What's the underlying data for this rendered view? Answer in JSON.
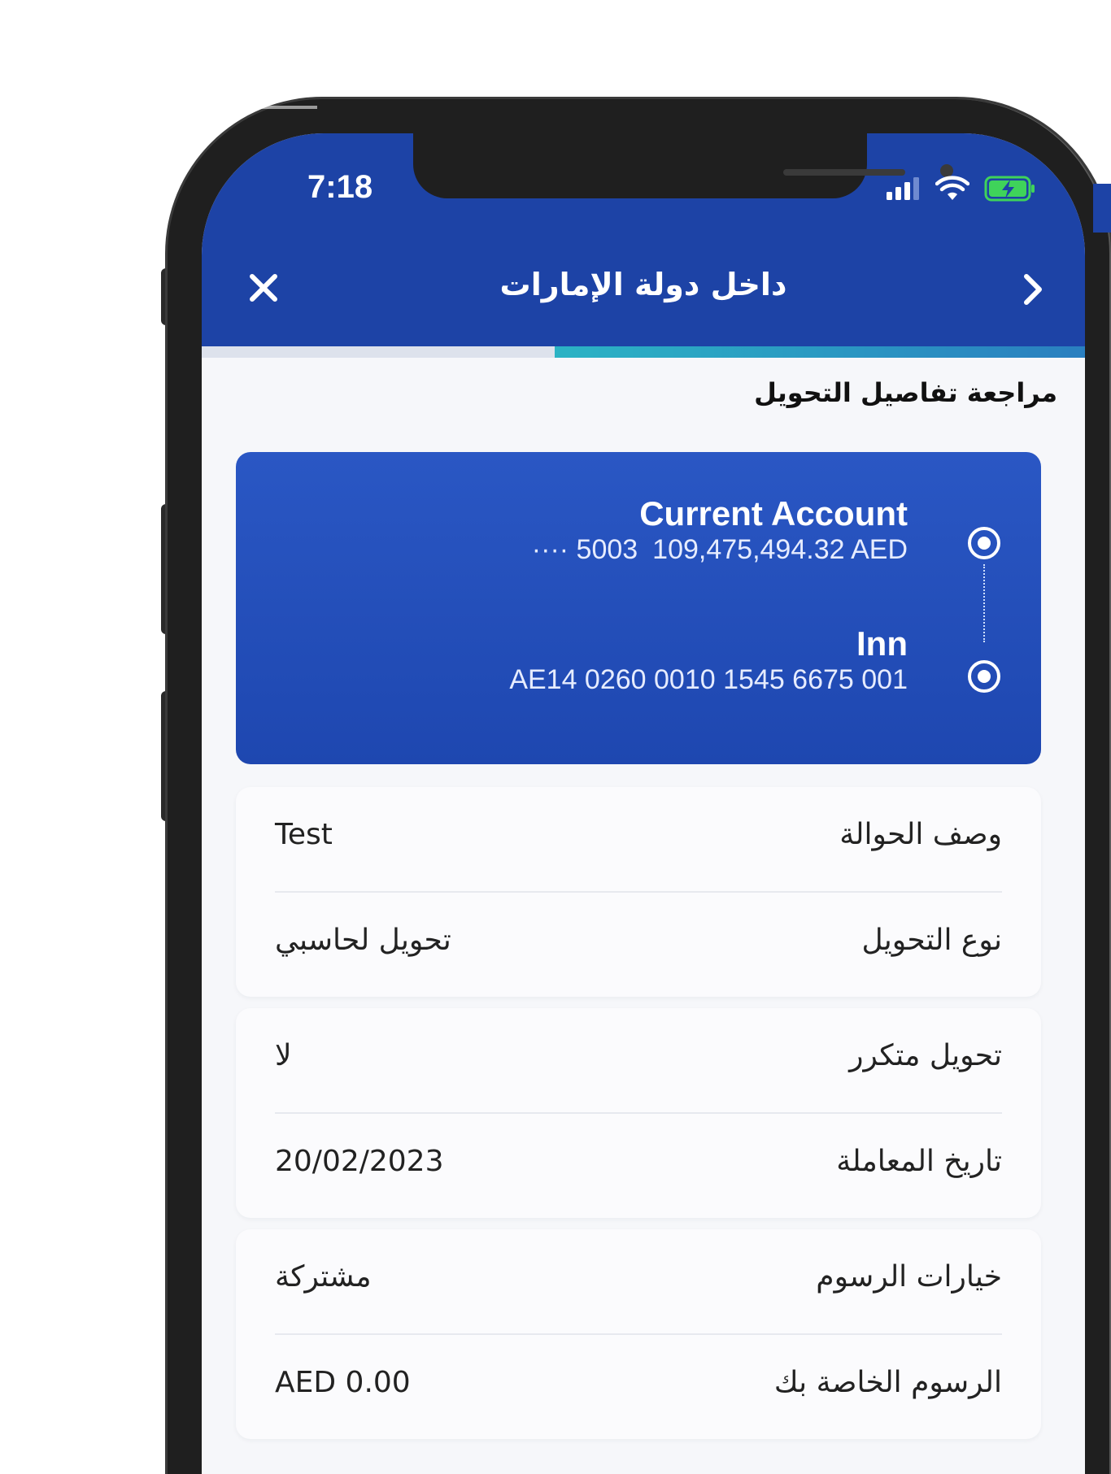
{
  "status_bar": {
    "time": "7:18"
  },
  "header": {
    "title": "داخل دولة الإمارات",
    "close_icon": "close-icon",
    "back_icon": "chevron-right-icon"
  },
  "progress": {
    "fraction": 0.6
  },
  "section": {
    "title": "مراجعة تفاصيل التحويل"
  },
  "from_account": {
    "name": "Current Account",
    "number_masked": "···· 5003",
    "balance": "109,475,494.32 AED"
  },
  "to_account": {
    "name": "Inn",
    "iban": "AE14 0260 0010 1545 6675 001"
  },
  "details": [
    {
      "label": "وصف الحوالة",
      "value": "Test"
    },
    {
      "label": "نوع التحويل",
      "value": "تحويل لحاسبي"
    },
    {
      "label": "تحويل متكرر",
      "value": "لا"
    },
    {
      "label": "تاريخ المعاملة",
      "value": "20/02/2023"
    },
    {
      "label": "خيارات الرسوم",
      "value": "مشتركة"
    },
    {
      "label": "الرسوم الخاصة بك",
      "value": "AED 0.00"
    }
  ],
  "colors": {
    "header_blue": "#1d43a6",
    "card_blue": "#2a57c4",
    "progress_teal": "#2bb3c4",
    "battery_green": "#3fd35a"
  }
}
